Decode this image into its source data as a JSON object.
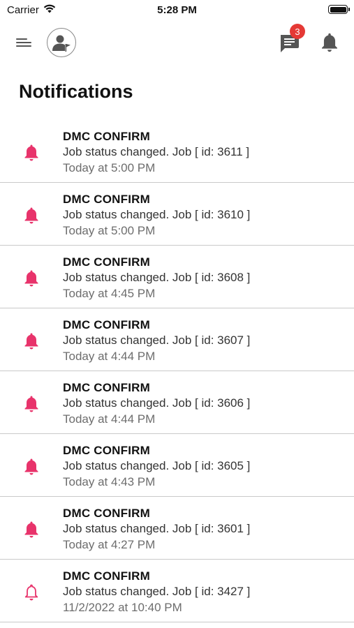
{
  "status_bar": {
    "carrier": "Carrier",
    "time": "5:28 PM"
  },
  "header": {
    "chat_badge_count": "3"
  },
  "page_title": "Notifications",
  "colors": {
    "accent": "#e8336b",
    "badge": "#e53935",
    "icon_gray": "#555555"
  },
  "notifications": [
    {
      "title": "DMC CONFIRM",
      "message": "Job status changed. Job [ id: 3611 ]",
      "time": "Today at 5:00 PM",
      "icon": "bell-filled-icon"
    },
    {
      "title": "DMC CONFIRM",
      "message": "Job status changed. Job [ id: 3610 ]",
      "time": "Today at 5:00 PM",
      "icon": "bell-filled-icon"
    },
    {
      "title": "DMC CONFIRM",
      "message": "Job status changed. Job [ id: 3608 ]",
      "time": "Today at 4:45 PM",
      "icon": "bell-filled-icon"
    },
    {
      "title": "DMC CONFIRM",
      "message": "Job status changed. Job [ id: 3607 ]",
      "time": "Today at 4:44 PM",
      "icon": "bell-filled-icon"
    },
    {
      "title": "DMC CONFIRM",
      "message": "Job status changed. Job [ id: 3606 ]",
      "time": "Today at 4:44 PM",
      "icon": "bell-filled-icon"
    },
    {
      "title": "DMC CONFIRM",
      "message": "Job status changed. Job [ id: 3605 ]",
      "time": "Today at 4:43 PM",
      "icon": "bell-filled-icon"
    },
    {
      "title": "DMC CONFIRM",
      "message": "Job status changed. Job [ id: 3601 ]",
      "time": "Today at 4:27 PM",
      "icon": "bell-filled-icon"
    },
    {
      "title": "DMC CONFIRM",
      "message": "Job status changed. Job [ id: 3427 ]",
      "time": "11/2/2022 at 10:40 PM",
      "icon": "bell-outline-icon"
    }
  ]
}
